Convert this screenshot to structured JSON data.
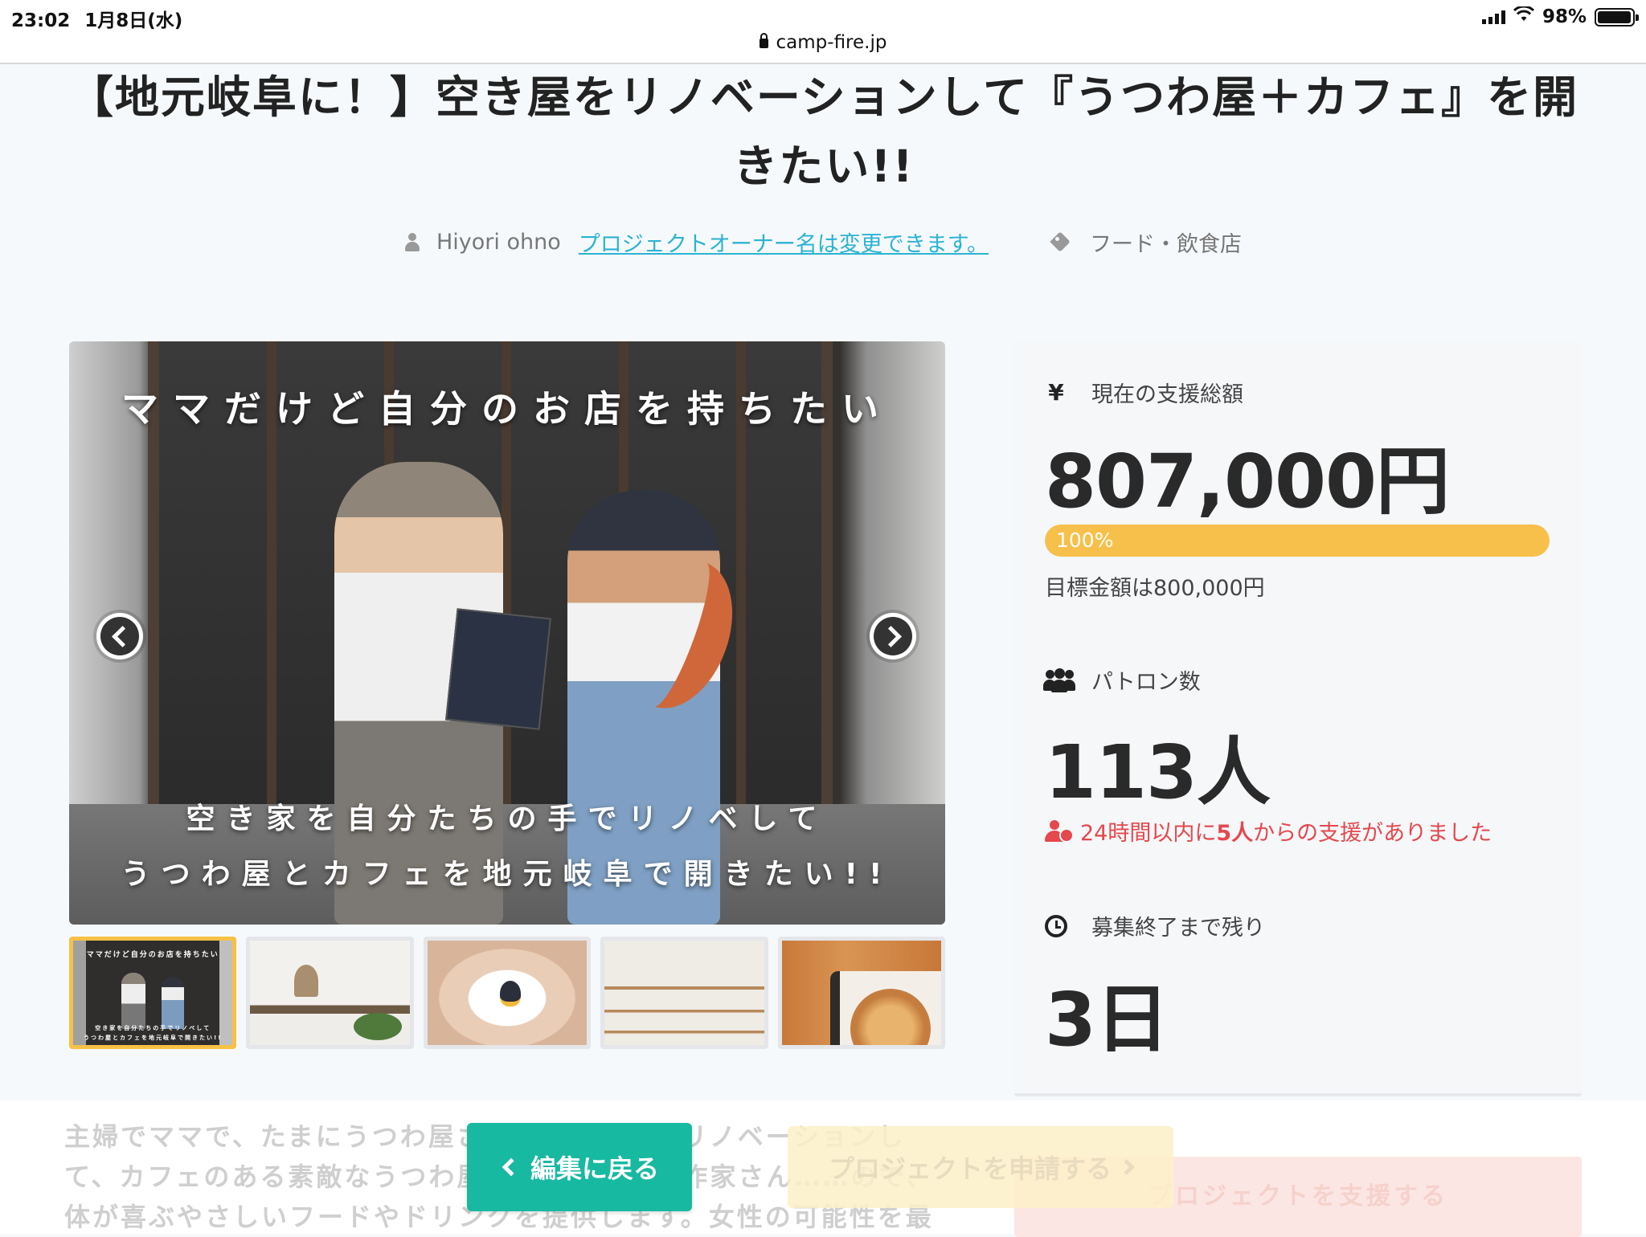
{
  "status_bar": {
    "time": "23:02",
    "date": "1月8日(水)",
    "battery": "98%"
  },
  "browser": {
    "url": "camp-fire.jp"
  },
  "project": {
    "title": "【地元岐阜に！】空き屋をリノベーションして『うつわ屋＋カフェ』を開きたい!!",
    "owner_name": "Hiyori ohno",
    "owner_change_link": "プロジェクトオーナー名は変更できます。",
    "category": "フード・飲食店"
  },
  "hero": {
    "overlay_top": "ママだけど自分のお店を持ちたい",
    "overlay_line1": "空き家を自分たちの手でリノベして",
    "overlay_line2": "うつわ屋とカフェを地元岐阜で開きたい!!",
    "thumbnail_count": 5,
    "active_thumbnail": 1
  },
  "thumb1": {
    "line_top": "ママだけど自分のお店を持ちたい",
    "line_bottom1": "空き家を自分たちの手でリノベして",
    "line_bottom2": "うつわ屋とカフェを地元岐阜で開きたい!!"
  },
  "stats": {
    "funding_label": "現在の支援総額",
    "funding_amount": "807,000円",
    "progress_percent": 100,
    "progress_text": "100%",
    "goal_text": "目標金額は800,000円",
    "patron_label": "パトロン数",
    "patron_count": "113人",
    "recent_prefix": "24時間以内に",
    "recent_count": "5人",
    "recent_suffix": "からの支援がありました",
    "remaining_label": "募集終了まで残り",
    "remaining_value": "3日"
  },
  "bottom": {
    "description": "主婦でママで、たまにうつわ屋さん……空き家をリノベーションして、カフェのある素敵なうつわ屋さん……たい！作家さん……ので、体が喜ぶやさしいフードやドリンクを提供します。女性の可能性を最",
    "ghost_button": "プロジェクトを支援する",
    "back_button": "編集に戻る",
    "apply_button": "プロジェクトを申請する"
  },
  "colors": {
    "accent_teal": "#17b9a1",
    "progress_yellow": "#f7c04a",
    "link_blue": "#2bb3d3",
    "alert_red": "#e5484d"
  }
}
